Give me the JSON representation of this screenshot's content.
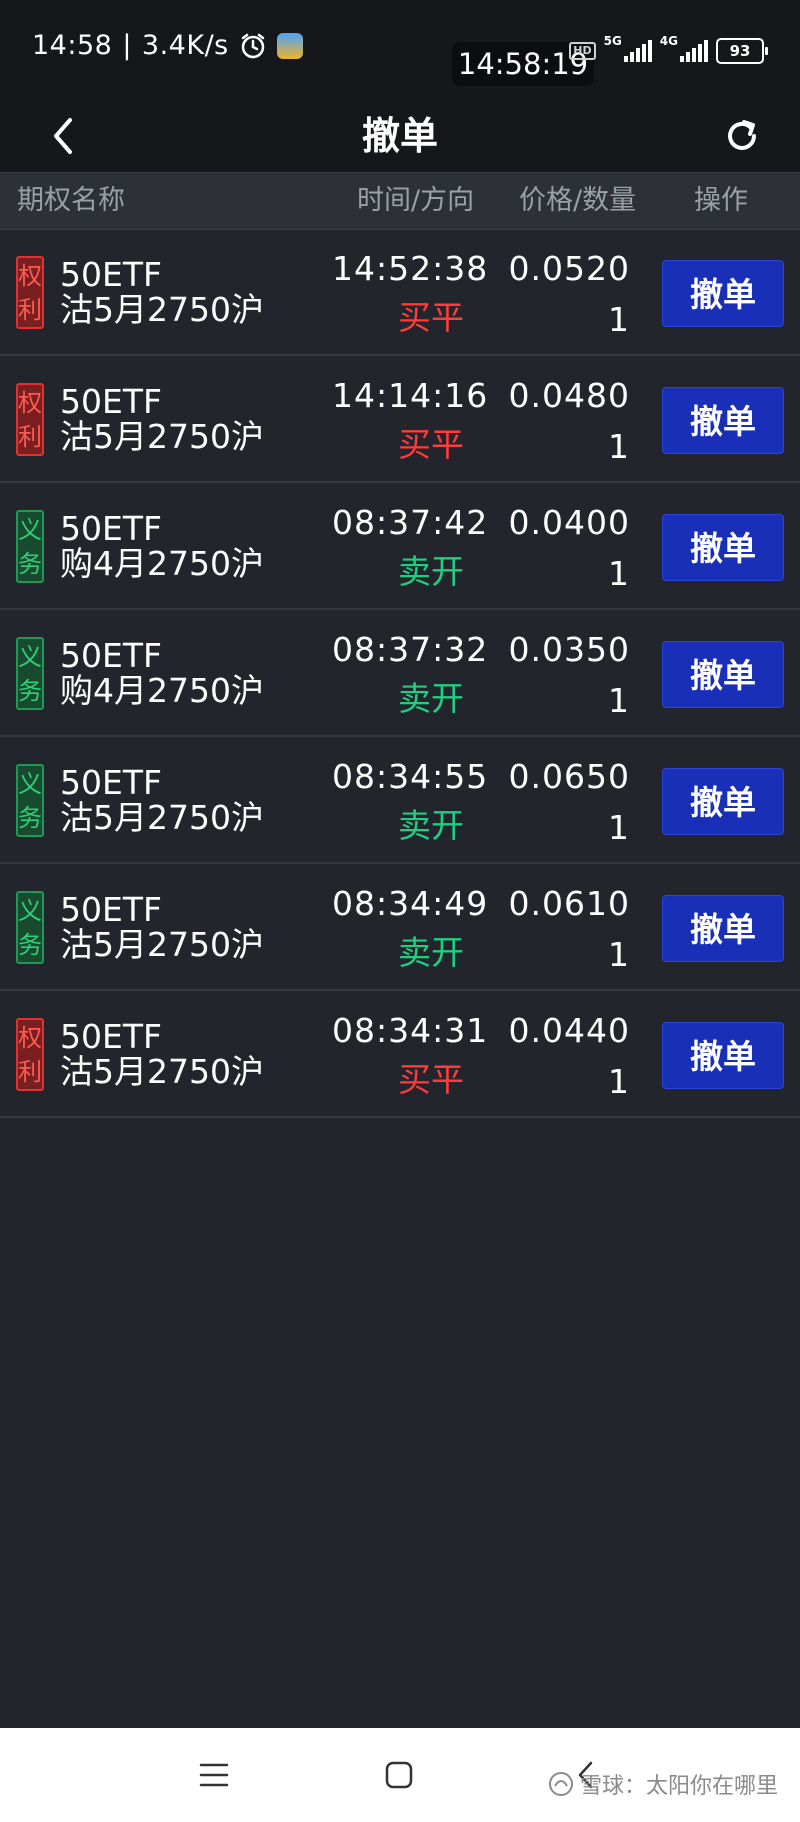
{
  "status_bar": {
    "time": "14:58",
    "speed": "3.4K/s",
    "overlay_time": "14:58:19",
    "hd": "HD",
    "net1": "5G",
    "net2": "4G",
    "battery": "93"
  },
  "header": {
    "title": "撤单"
  },
  "table_header": {
    "name": "期权名称",
    "time_dir": "时间/方向",
    "price_qty": "价格/数量",
    "operation": "操作"
  },
  "orders": [
    {
      "tag_top": "权",
      "tag_bottom": "利",
      "tag_type": "red",
      "name1": "50ETF",
      "name2": "沽5月2750沪",
      "time": "14:52:38",
      "direction": "买平",
      "dir_type": "red",
      "price": "0.0520",
      "qty": "1",
      "action": "撤单"
    },
    {
      "tag_top": "权",
      "tag_bottom": "利",
      "tag_type": "red",
      "name1": "50ETF",
      "name2": "沽5月2750沪",
      "time": "14:14:16",
      "direction": "买平",
      "dir_type": "red",
      "price": "0.0480",
      "qty": "1",
      "action": "撤单"
    },
    {
      "tag_top": "义",
      "tag_bottom": "务",
      "tag_type": "green",
      "name1": "50ETF",
      "name2": "购4月2750沪",
      "time": "08:37:42",
      "direction": "卖开",
      "dir_type": "green",
      "price": "0.0400",
      "qty": "1",
      "action": "撤单"
    },
    {
      "tag_top": "义",
      "tag_bottom": "务",
      "tag_type": "green",
      "name1": "50ETF",
      "name2": "购4月2750沪",
      "time": "08:37:32",
      "direction": "卖开",
      "dir_type": "green",
      "price": "0.0350",
      "qty": "1",
      "action": "撤单"
    },
    {
      "tag_top": "义",
      "tag_bottom": "务",
      "tag_type": "green",
      "name1": "50ETF",
      "name2": "沽5月2750沪",
      "time": "08:34:55",
      "direction": "卖开",
      "dir_type": "green",
      "price": "0.0650",
      "qty": "1",
      "action": "撤单"
    },
    {
      "tag_top": "义",
      "tag_bottom": "务",
      "tag_type": "green",
      "name1": "50ETF",
      "name2": "沽5月2750沪",
      "time": "08:34:49",
      "direction": "卖开",
      "dir_type": "green",
      "price": "0.0610",
      "qty": "1",
      "action": "撤单"
    },
    {
      "tag_top": "权",
      "tag_bottom": "利",
      "tag_type": "red",
      "name1": "50ETF",
      "name2": "沽5月2750沪",
      "time": "08:34:31",
      "direction": "买平",
      "dir_type": "red",
      "price": "0.0440",
      "qty": "1",
      "action": "撤单"
    }
  ],
  "watermark": "雪球：太阳你在哪里",
  "colors": {
    "background": "#22252b",
    "bar": "#15171b",
    "button_blue": "#1a2fb8",
    "buy_red": "#ff3b3b",
    "sell_green": "#1fcf82"
  },
  "icons": {
    "back": "chevron-left-icon",
    "refresh": "refresh-icon",
    "alarm": "alarm-clock-icon",
    "menu": "menu-icon",
    "home": "home-icon",
    "sys_back": "back-icon"
  }
}
